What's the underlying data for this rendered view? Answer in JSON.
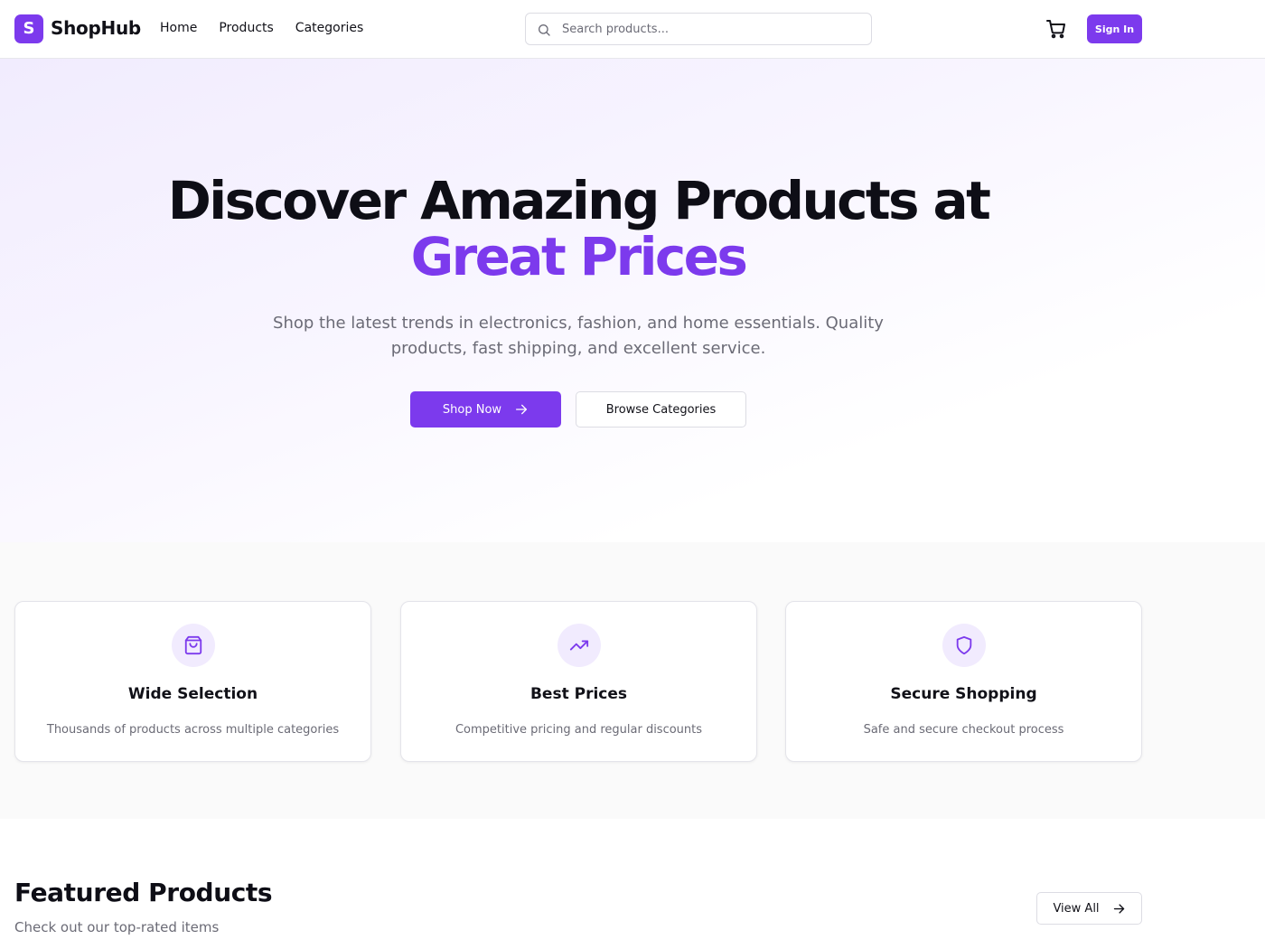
{
  "header": {
    "logo_letter": "S",
    "logo_text": "ShopHub",
    "nav": [
      "Home",
      "Products",
      "Categories"
    ],
    "search": {
      "placeholder": "Search products..."
    },
    "signin_label": "Sign In"
  },
  "hero": {
    "title_line1": "Discover Amazing Products at",
    "title_line2": "Great Prices",
    "subtitle": "Shop the latest trends in electronics, fashion, and home essentials. Quality products, fast shipping, and excellent service.",
    "primary_cta": "Shop Now",
    "secondary_cta": "Browse Categories"
  },
  "features": [
    {
      "icon": "shopping-bag-icon",
      "title": "Wide Selection",
      "description": "Thousands of products across multiple categories"
    },
    {
      "icon": "trending-up-icon",
      "title": "Best Prices",
      "description": "Competitive pricing and regular discounts"
    },
    {
      "icon": "shield-icon",
      "title": "Secure Shopping",
      "description": "Safe and secure checkout process"
    }
  ],
  "featured": {
    "title": "Featured Products",
    "subtitle": "Check out our top-rated items",
    "view_all": "View All"
  },
  "colors": {
    "accent": "#7c3aed",
    "accent_soft": "#f1ebfe",
    "muted_text": "#6b6b76",
    "border": "#dcdce3"
  }
}
